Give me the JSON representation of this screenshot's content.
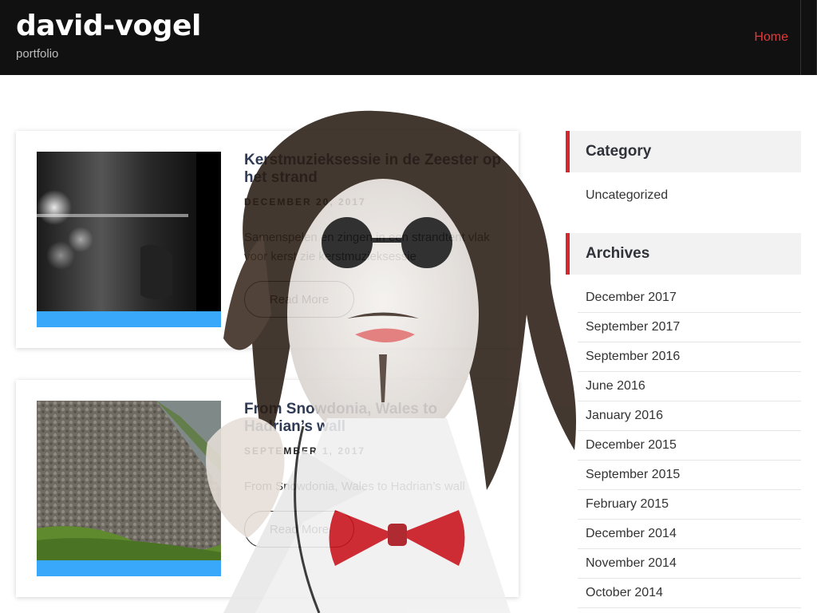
{
  "header": {
    "site_title": "david-vogel",
    "tagline": "portfolio",
    "nav": [
      {
        "label": "Home"
      }
    ]
  },
  "posts": [
    {
      "title": "Kerstmuziek­sessie in de Zeester op het strand",
      "date": "DECEMBER 20, 2017",
      "excerpt": "Samenspelen en zingen in een strandtent vlak voor kerst zie kerstmuzieksessie",
      "read_more": "Read More"
    },
    {
      "title": "From Snowdonia, Wales to Hadrian’s wall",
      "date": "SEPTEMBER 1, 2017",
      "excerpt": "From Snowdonia, Wales to Hadrian’s wall",
      "read_more": "Read More"
    }
  ],
  "sidebar": {
    "category_title": "Category",
    "categories": [
      "Uncategorized"
    ],
    "archives_title": "Archives",
    "archives": [
      "December 2017",
      "September 2017",
      "September 2016",
      "June 2016",
      "January 2016",
      "December 2015",
      "September 2015",
      "February 2015",
      "December 2014",
      "November 2014",
      "October 2014"
    ]
  },
  "colors": {
    "header_bg": "#111111",
    "nav_active": "#e03a3a",
    "thumb_bar": "#39a8fb",
    "widget_accent": "#d3282f"
  }
}
